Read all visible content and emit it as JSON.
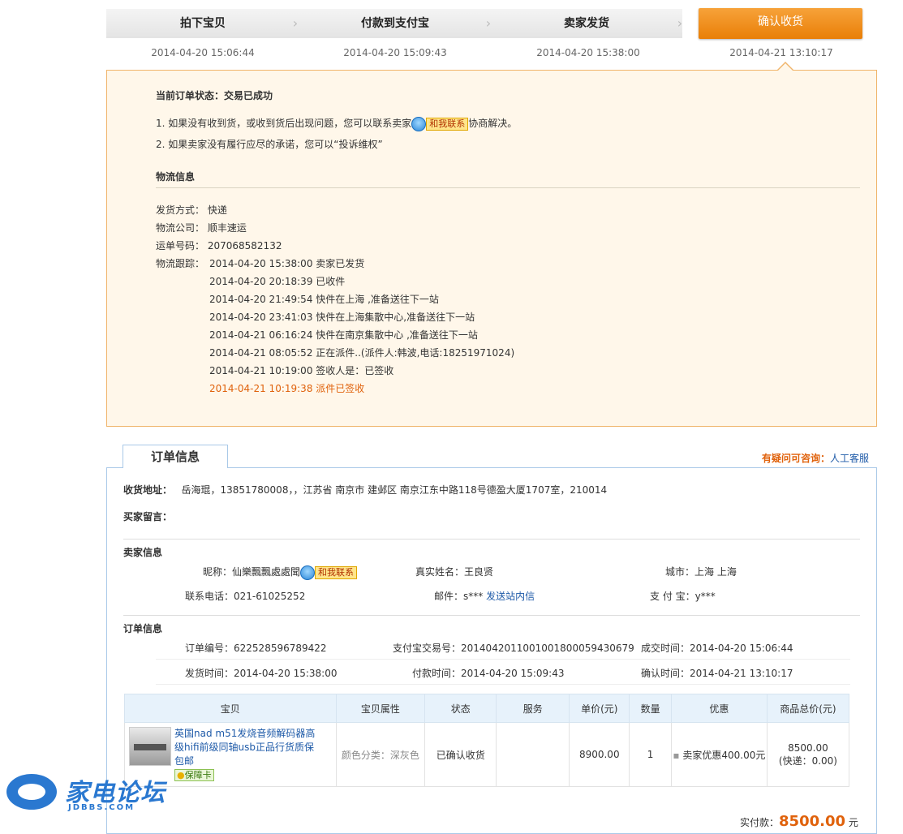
{
  "steps": [
    {
      "label": "拍下宝贝",
      "time": "2014-04-20 15:06:44"
    },
    {
      "label": "付款到支付宝",
      "time": "2014-04-20 15:09:43"
    },
    {
      "label": "卖家发货",
      "time": "2014-04-20 15:38:00"
    },
    {
      "label": "确认收货",
      "time": "2014-04-21 13:10:17"
    }
  ],
  "status": {
    "label": "当前订单状态：",
    "value": "交易已成功",
    "tip1_prefix": "1.   如果没有收到货，或收到货后出现问题，您可以联系卖家",
    "tip1_suffix": "协商解决。",
    "tip2": "2.   如果卖家没有履行应尽的承诺，您可以“投诉维权”",
    "contact_label": "和我联系"
  },
  "logistics": {
    "title": "物流信息",
    "method_label": "发货方式：",
    "method": "快递",
    "company_label": "物流公司：",
    "company": "顺丰速运",
    "waybill_label": "运单号码：",
    "waybill": "207068582132",
    "track_label": "物流跟踪：",
    "tracking": [
      "2014-04-20 15:38:00 卖家已发货",
      "2014-04-20 20:18:39 已收件",
      "2014-04-20 21:49:54 快件在上海 ,准备送往下一站",
      "2014-04-20 23:41:03 快件在上海集散中心,准备送往下一站",
      "2014-04-21 06:16:24 快件在南京集散中心 ,准备送往下一站",
      "2014-04-21 08:05:52 正在派件..(派件人:韩波,电话:18251971024)",
      "2014-04-21 10:19:00 签收人是：已签收",
      "2014-04-21 10:19:38 派件已签收"
    ]
  },
  "order_tab": "订单信息",
  "help": {
    "question": "有疑问可咨询：",
    "link": "人工客服"
  },
  "address": {
    "label": "收货地址：",
    "value": "岳海琨，13851780008，，江苏省 南京市 建邺区 南京江东中路118号德盈大厦1707室，210014"
  },
  "buyer_note_label": "买家留言：",
  "seller": {
    "title": "卖家信息",
    "nick_label": "昵称：",
    "nick": "仙樂飄飄處處聞",
    "realname_label": "真实姓名：",
    "realname": "王良贤",
    "city_label": "城市：",
    "city": "上海 上海",
    "phone_label": "联系电话：",
    "phone": "021-61025252",
    "email_label": "邮件：",
    "email": "s***",
    "email_link": "发送站内信",
    "alipay_label": "支 付 宝：",
    "alipay": "y***"
  },
  "order": {
    "title": "订单信息",
    "number_label": "订单编号：",
    "number": "622528596789422",
    "trade_label": "支付宝交易号：",
    "trade": "2014042011001001800059430679",
    "deal_label": "成交时间：",
    "deal": "2014-04-20 15:06:44",
    "ship_label": "发货时间：",
    "ship": "2014-04-20 15:38:00",
    "pay_label": "付款时间：",
    "pay": "2014-04-20 15:09:43",
    "confirm_label": "确认时间：",
    "confirm": "2014-04-21 13:10:17"
  },
  "table": {
    "headers": [
      "宝贝",
      "宝贝属性",
      "状态",
      "服务",
      "单价(元)",
      "数量",
      "优惠",
      "商品总价(元)"
    ],
    "item": {
      "title": "英国nad m51发烧音频解码器高级hifi前级同轴usb正品行货质保包邮",
      "badge": "保障卡",
      "attr": "颜色分类：深灰色",
      "status": "已确认收货",
      "service": "",
      "price": "8900.00",
      "qty": "1",
      "discount": "卖家优惠400.00元",
      "total": "8500.00",
      "shipping": "(快递：0.00)"
    }
  },
  "payment": {
    "label": "实付款：",
    "amount": "8500.00",
    "unit": "元"
  },
  "watermark": {
    "brand": "家电论坛",
    "site": "JDBBS.COM"
  }
}
